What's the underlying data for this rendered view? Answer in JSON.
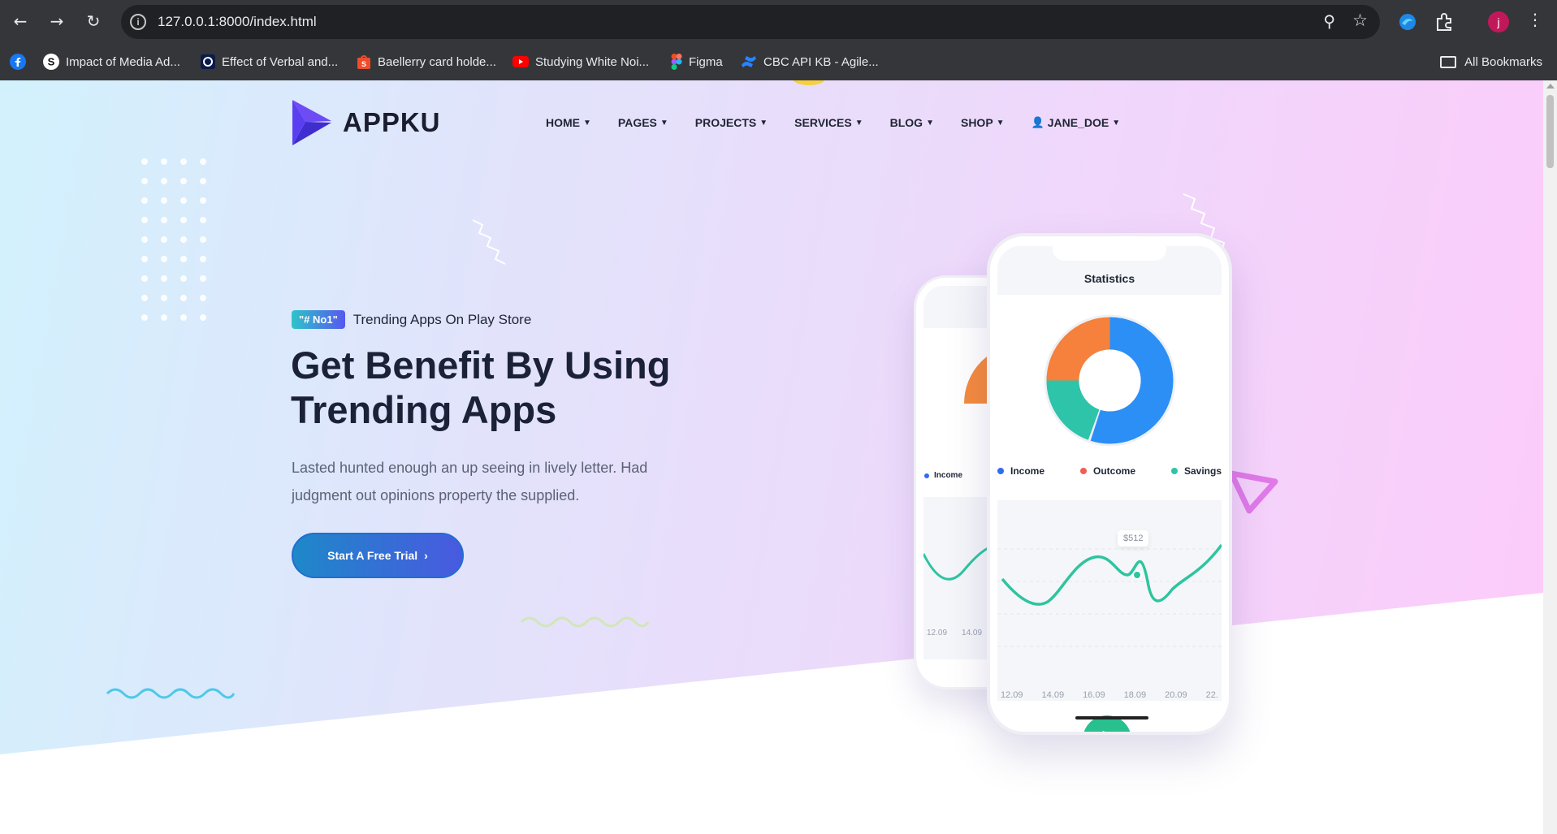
{
  "browser": {
    "url": "127.0.0.1:8000/index.html",
    "profile_initial": "j",
    "bookmarks": [
      {
        "label": "Impact of Media Ad...",
        "icon": "s-icon",
        "color": "#ffffff"
      },
      {
        "label": "Effect of Verbal and...",
        "icon": "circle-o-icon",
        "color": "#0a1a4a"
      },
      {
        "label": "Baellerry card holde...",
        "icon": "shopee-bag-icon",
        "color": "#ee4d2d"
      },
      {
        "label": "Studying White Noi...",
        "icon": "youtube-icon",
        "color": "#ff0000"
      },
      {
        "label": "Figma",
        "icon": "figma-icon",
        "color": "#a259ff"
      },
      {
        "label": "CBC API KB - Agile...",
        "icon": "confluence-icon",
        "color": "#2684ff"
      }
    ],
    "all_bookmarks_label": "All Bookmarks"
  },
  "site": {
    "logo_text": "APPKU",
    "nav": [
      {
        "label": "HOME"
      },
      {
        "label": "PAGES"
      },
      {
        "label": "PROJECTS"
      },
      {
        "label": "SERVICES"
      },
      {
        "label": "BLOG"
      },
      {
        "label": "SHOP"
      },
      {
        "label": "JANE_DOE"
      }
    ]
  },
  "hero": {
    "badge": "\"# No1\"",
    "badge_caption": "Trending Apps On Play Store",
    "title_line1": "Get Benefit By Using",
    "title_line2": "Trending Apps",
    "description": "Lasted hunted enough an up seeing in lively letter. Had judgment out opinions property the supplied.",
    "cta_label": "Start A Free Trial"
  },
  "phone": {
    "title": "Statistics",
    "legend": [
      {
        "label": "Income",
        "color": "#2f6cf0"
      },
      {
        "label": "Outcome",
        "color": "#f25c54"
      },
      {
        "label": "Savings",
        "color": "#2ec4a9"
      }
    ],
    "tooltip": "$512",
    "x_labels": [
      "12.09",
      "14.09",
      "16.09",
      "18.09",
      "20.09",
      "22."
    ],
    "back_legend": "Income",
    "back_x_labels": [
      "12.09",
      "14.09"
    ]
  },
  "colors": {
    "accent": "#4959e0",
    "brand_purple": "#5a3ff0",
    "line_green": "#2ec4a0"
  }
}
